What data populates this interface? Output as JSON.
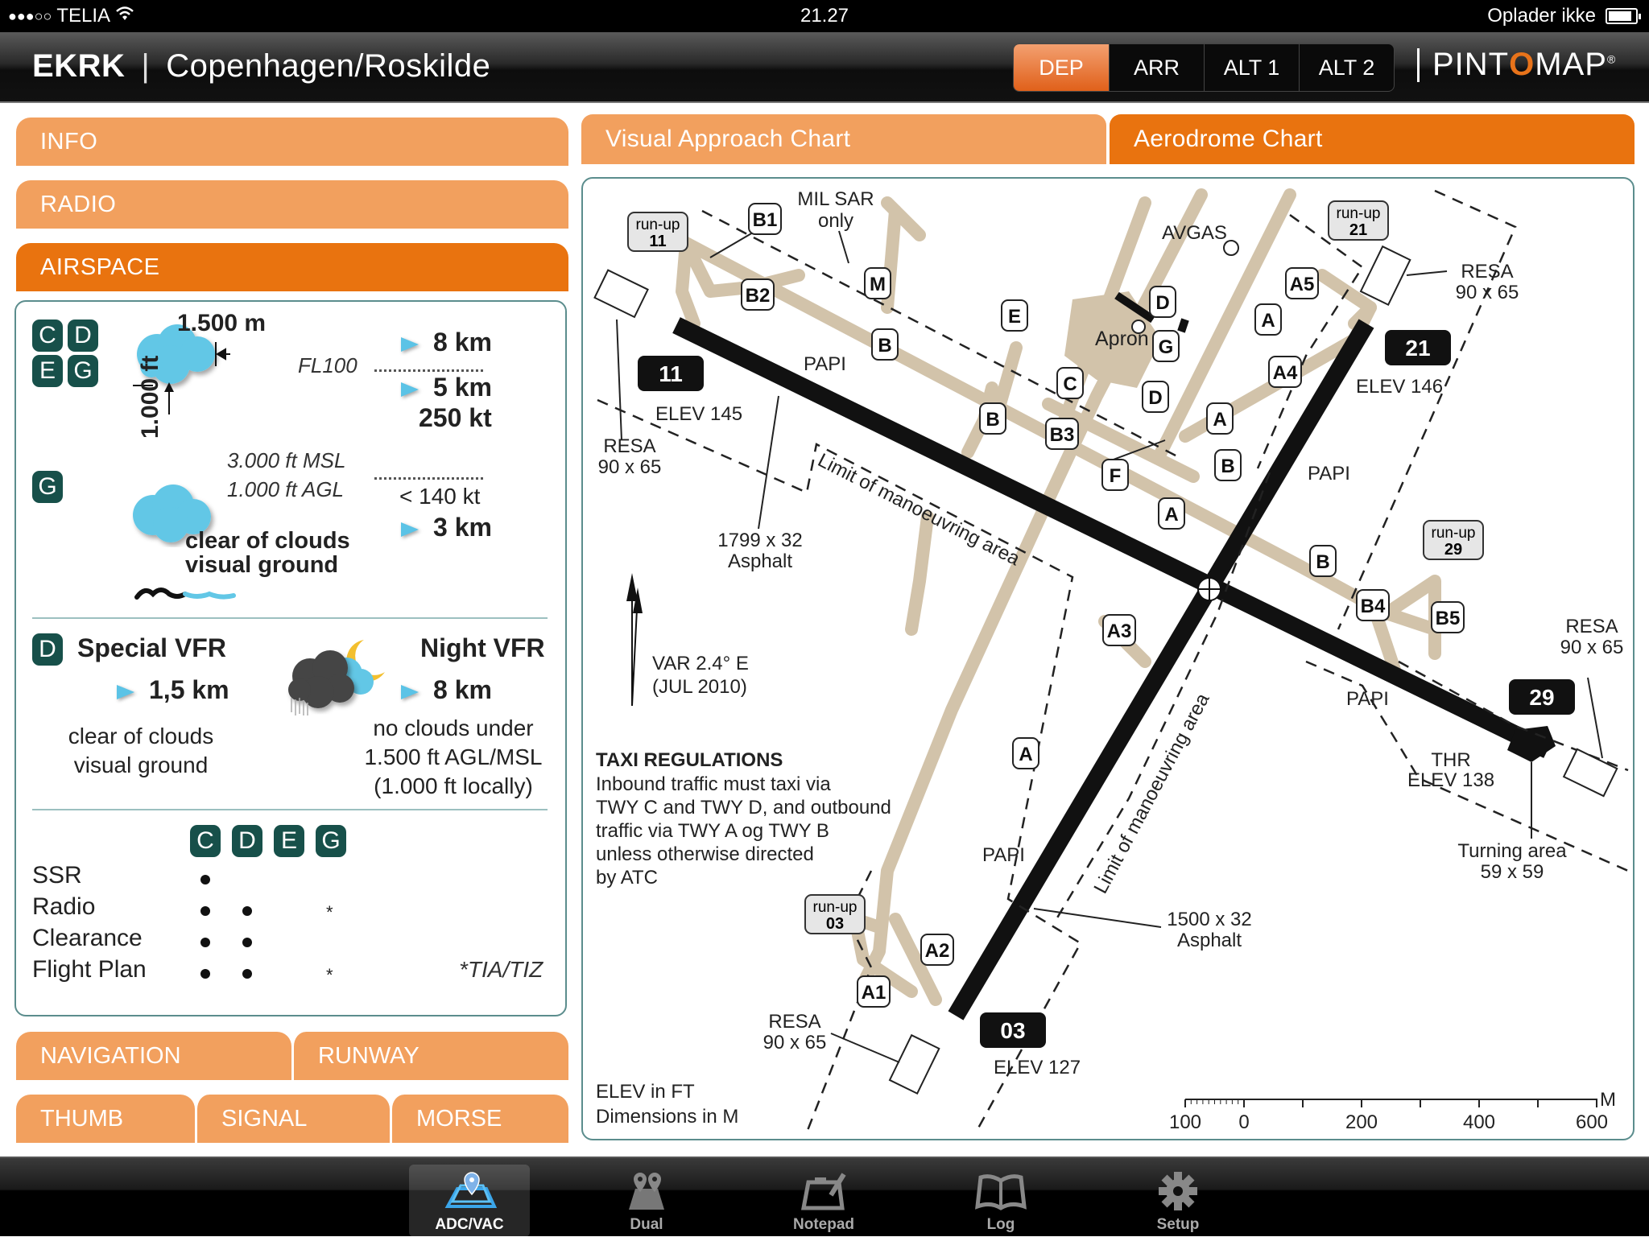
{
  "status_bar": {
    "signal": "●●●○○",
    "carrier": "TELIA",
    "time": "21.27",
    "battery_status": "Oplader ikke"
  },
  "header": {
    "airport_code": "EKRK",
    "separator": "|",
    "airport_name": "Copenhagen/Roskilde",
    "segments": [
      {
        "label": "DEP",
        "active": true
      },
      {
        "label": "ARR",
        "active": false
      },
      {
        "label": "ALT 1",
        "active": false
      },
      {
        "label": "ALT 2",
        "active": false
      }
    ],
    "brand_prefix": "PINT",
    "brand_o": "O",
    "brand_suffix": "MAP",
    "brand_reg": "®"
  },
  "left_menu": {
    "info": "INFO",
    "radio": "RADIO",
    "airspace": "AIRSPACE",
    "bottom_row1": [
      "NAVIGATION",
      "RUNWAY"
    ],
    "bottom_row2": [
      "THUMB",
      "SIGNAL",
      "MORSE"
    ]
  },
  "airspace": {
    "classes_top": [
      "C",
      "D",
      "E",
      "G"
    ],
    "horizontal_clearance": "1.500 m",
    "vertical_clearance": "1.000 ft",
    "above_fl100_vis": "8 km",
    "fl100_label": "FL100",
    "below_fl100_vis": "5 km",
    "speed_limit": "250 kt",
    "class_g_badge": "G",
    "g_alt_msl": "3.000 ft MSL",
    "g_alt_agl": "1.000 ft AGL",
    "g_speed": "< 140 kt",
    "g_vis": "3 km",
    "g_line1": "clear of clouds",
    "g_line2": "visual ground",
    "special_vfr_badge": "D",
    "special_vfr_title": "Special VFR",
    "special_vfr_vis": "1,5 km",
    "special_vfr_line1": "clear of clouds",
    "special_vfr_line2": "visual ground",
    "night_vfr_title": "Night VFR",
    "night_vfr_vis": "8 km",
    "night_vfr_line1": "no clouds under",
    "night_vfr_line2": "1.500 ft AGL/MSL",
    "night_vfr_line3": "(1.000 ft locally)",
    "req_classes": [
      "C",
      "D",
      "E",
      "G"
    ],
    "requirements": [
      {
        "label": "SSR",
        "C": "•",
        "D": "",
        "E": "",
        "G": ""
      },
      {
        "label": "Radio",
        "C": "•",
        "D": "•",
        "E": "",
        "G": "*"
      },
      {
        "label": "Clearance",
        "C": "•",
        "D": "•",
        "E": "",
        "G": ""
      },
      {
        "label": "Flight Plan",
        "C": "•",
        "D": "•",
        "E": "",
        "G": "*"
      }
    ],
    "footnote": "*TIA/TIZ"
  },
  "chart_tabs": [
    {
      "label": "Visual Approach Chart",
      "active": false
    },
    {
      "label": "Aerodrome Chart",
      "active": true
    }
  ],
  "aerodrome_chart": {
    "runways": [
      {
        "id": "11",
        "elev": "ELEV 145",
        "dims": "1799 x 32",
        "surface": "Asphalt"
      },
      {
        "id": "29",
        "elev": "THR\nELEV 138"
      },
      {
        "id": "03",
        "elev": "ELEV 127",
        "dims": "1500 x 32",
        "surface": "Asphalt"
      },
      {
        "id": "21",
        "elev": "ELEV 146"
      }
    ],
    "labels": {
      "runup_11": [
        "run-up",
        "11"
      ],
      "runup_21": [
        "run-up",
        "21"
      ],
      "runup_29": [
        "run-up",
        "29"
      ],
      "runup_03": [
        "run-up",
        "03"
      ],
      "mil_sar": [
        "MIL SAR",
        "only"
      ],
      "avgas": "AVGAS",
      "apron": "Apron",
      "papi": "PAPI",
      "resa": [
        "RESA",
        "90 x 65"
      ],
      "limit": "Limit of manoeuvring area",
      "var": [
        "VAR 2.4° E",
        "(JUL 2010)"
      ],
      "turning": [
        "Turning area",
        "59 x 59"
      ],
      "rwy11_dims": [
        "1799 x 32",
        "Asphalt"
      ],
      "rwy03_dims": [
        "1500 x 32",
        "Asphalt"
      ],
      "elev_11": "ELEV 145",
      "elev_21": "ELEV 146",
      "elev_29": [
        "THR",
        "ELEV 138"
      ],
      "elev_03": "ELEV 127",
      "units": [
        "ELEV in FT",
        "Dimensions in M"
      ]
    },
    "taxiways": [
      "B1",
      "B2",
      "M",
      "E",
      "B",
      "B",
      "B3",
      "C",
      "D",
      "D",
      "G",
      "A5",
      "A",
      "A4",
      "A",
      "F",
      "B",
      "A",
      "B",
      "B4",
      "B5",
      "A3",
      "A",
      "A2",
      "A1"
    ],
    "taxi_regulations": {
      "title": "TAXI REGULATIONS",
      "lines": [
        "Inbound traffic must taxi via",
        "TWY C and TWY D, and outbound",
        "traffic via TWY A og TWY B",
        "unless otherwise directed",
        "by ATC"
      ]
    },
    "scale": {
      "ticks": [
        "100",
        "0",
        "200",
        "400",
        "600"
      ],
      "unit": "M"
    }
  },
  "tabbar": {
    "items": [
      {
        "label": "ADC/VAC",
        "icon": "map-pin-layers-icon",
        "active": true
      },
      {
        "label": "Dual",
        "icon": "dual-pins-icon",
        "active": false
      },
      {
        "label": "Notepad",
        "icon": "notepad-icon",
        "active": false
      },
      {
        "label": "Log",
        "icon": "book-icon",
        "active": false
      },
      {
        "label": "Setup",
        "icon": "gear-icon",
        "active": false
      }
    ]
  }
}
